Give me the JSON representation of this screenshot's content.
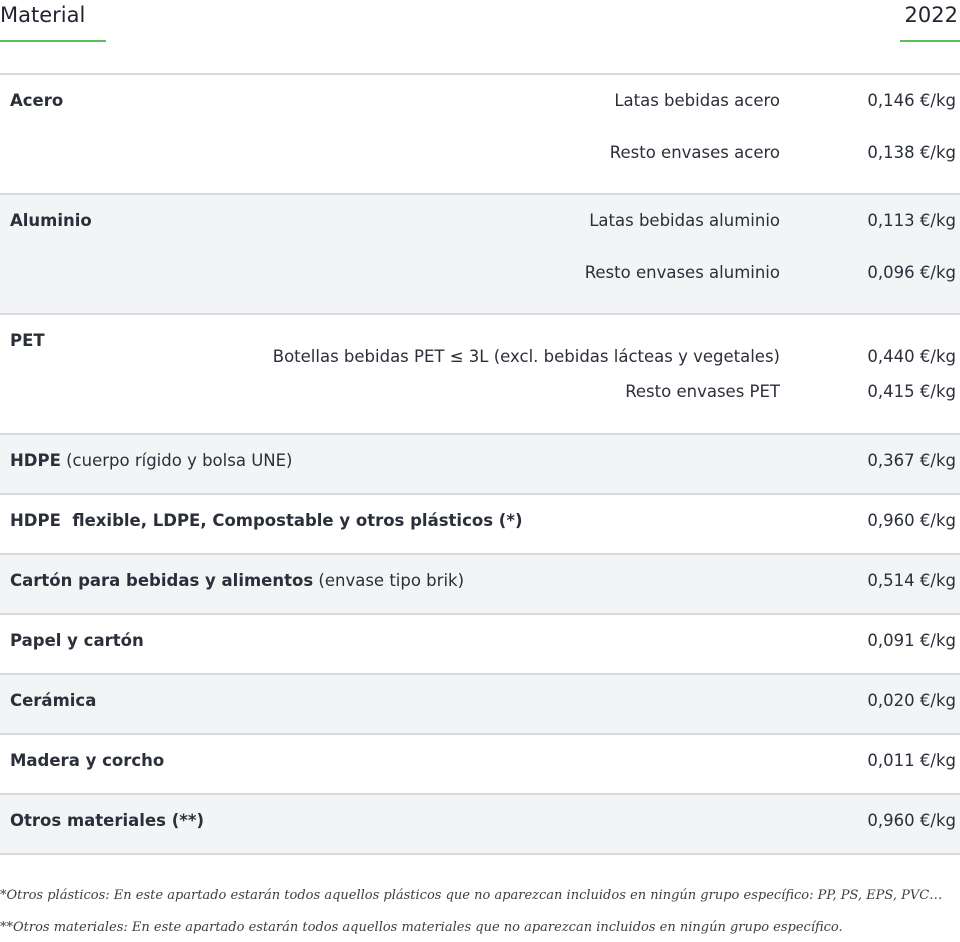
{
  "header": {
    "material_label": "Material",
    "year_label": "2022",
    "accent_color": "#5cc05a"
  },
  "rows": [
    {
      "material": "Acero",
      "note": "",
      "items": [
        {
          "label": "Latas bebidas acero",
          "price": "0,146 €/kg"
        },
        {
          "label": "Resto envases acero",
          "price": "0,138 €/kg"
        }
      ]
    },
    {
      "material": "Aluminio",
      "note": "",
      "items": [
        {
          "label": "Latas bebidas aluminio",
          "price": "0,113 €/kg"
        },
        {
          "label": "Resto envases aluminio",
          "price": "0,096 €/kg"
        }
      ]
    },
    {
      "material": "PET",
      "note": "",
      "items": [
        {
          "label": "Botellas bebidas PET ≤ 3L (excl. bebidas lácteas y vegetales)",
          "price": "0,440 €/kg"
        },
        {
          "label": "Resto envases PET",
          "price": "0,415 €/kg"
        }
      ]
    },
    {
      "material": "HDPE",
      "note": " (cuerpo rígido y bolsa UNE)",
      "price": "0,367 €/kg"
    },
    {
      "material": "HDPE  flexible, LDPE, Compostable y otros plásticos (*)",
      "note": "",
      "price": "0,960 €/kg"
    },
    {
      "material": "Cartón para bebidas y alimentos",
      "note": " (envase tipo brik)",
      "price": "0,514 €/kg"
    },
    {
      "material": "Papel y cartón",
      "note": "",
      "price": "0,091 €/kg"
    },
    {
      "material": "Cerámica",
      "note": "",
      "price": "0,020 €/kg"
    },
    {
      "material": "Madera y corcho",
      "note": "",
      "price": "0,011 €/kg"
    },
    {
      "material": "Otros materiales (**)",
      "note": "",
      "price": "0,960 €/kg"
    }
  ],
  "footnotes": [
    "*Otros plásticos: En este apartado estarán todos aquellos plásticos que no aparezcan incluidos en ningún grupo específico: PP, PS, EPS, PVC…",
    "**Otros materiales: En este apartado estarán todos aquellos materiales que no aparezcan incluidos en ningún grupo específico."
  ]
}
